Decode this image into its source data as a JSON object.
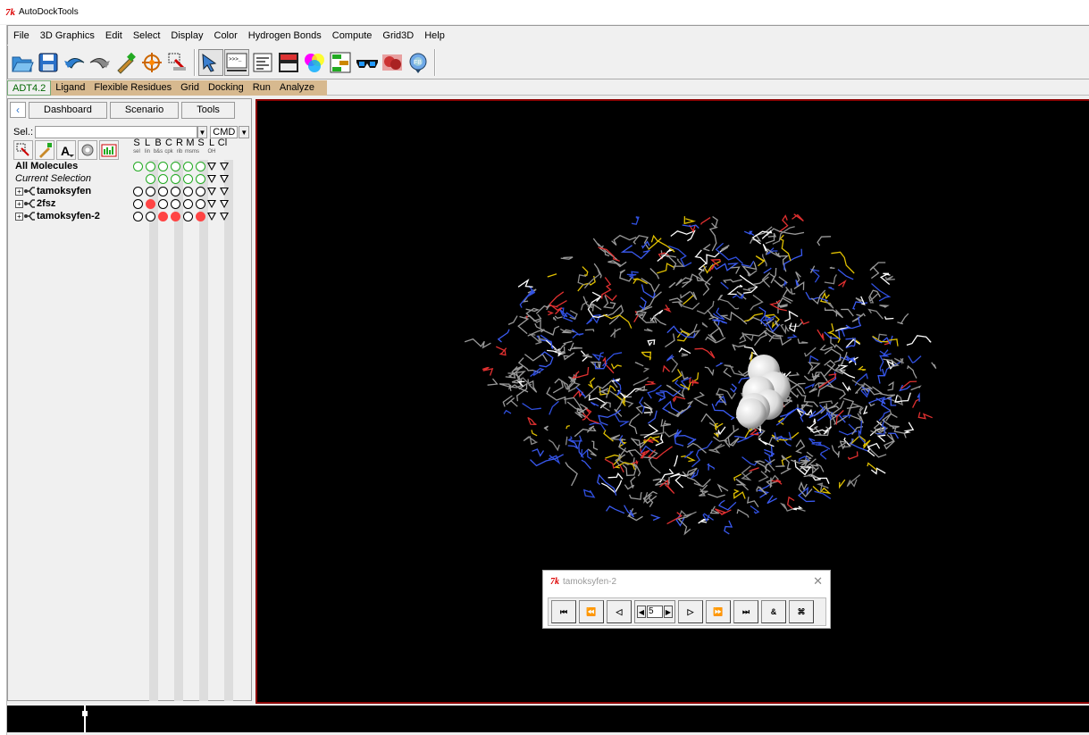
{
  "window": {
    "title": "AutoDockTools",
    "logo": "7k"
  },
  "menubar": [
    "File",
    "3D Graphics",
    "Edit",
    "Select",
    "Display",
    "Color",
    "Hydrogen Bonds",
    "Compute",
    "Grid3D",
    "Help"
  ],
  "toolbar": {
    "icons": [
      "open-folder-icon",
      "save-icon",
      "undo-icon",
      "redo-icon",
      "pick-icon",
      "center-icon",
      "clear-selection-icon",
      "pointer-icon",
      "python-shell-icon",
      "label-icon",
      "display-icon",
      "color-icon",
      "hierarchy-icon",
      "stereo-glasses-icon",
      "surface-icon",
      "fog-icon"
    ]
  },
  "modules": {
    "active": "ADT4.2",
    "items": [
      "Ligand",
      "Flexible Residues",
      "Grid",
      "Docking",
      "Run",
      "Analyze"
    ]
  },
  "dashboard": {
    "tabs": [
      "Dashboard",
      "Scenario",
      "Tools"
    ],
    "sel_label": "Sel.:",
    "sel_value": "",
    "cmd_label": "CMD",
    "columns": [
      {
        "letter": "S",
        "sub": "sel"
      },
      {
        "letter": "L",
        "sub": "lin"
      },
      {
        "letter": "B",
        "sub": "b&s"
      },
      {
        "letter": "C",
        "sub": "cpk"
      },
      {
        "letter": "R",
        "sub": "rib"
      },
      {
        "letter": "M",
        "sub": "msms"
      },
      {
        "letter": "S",
        "sub": ""
      },
      {
        "letter": "L",
        "sub": "OH"
      },
      {
        "letter": "Cl",
        "sub": ""
      }
    ],
    "rows": [
      {
        "label": "All Molecules",
        "style": "bold",
        "expandable": false,
        "states": [
          "g",
          "g",
          "g",
          "g",
          "g",
          "g",
          "t",
          "t"
        ]
      },
      {
        "label": "Current Selection",
        "style": "italic",
        "expandable": false,
        "states": [
          "",
          "g",
          "g",
          "g",
          "g",
          "g",
          "t",
          "t"
        ]
      },
      {
        "label": "tamoksyfen",
        "style": "mol",
        "expandable": true,
        "states": [
          "o",
          "o",
          "o",
          "o",
          "o",
          "o",
          "t",
          "t"
        ]
      },
      {
        "label": "2fsz",
        "style": "mol",
        "expandable": true,
        "states": [
          "o",
          "r",
          "o",
          "o",
          "o",
          "o",
          "t",
          "t"
        ]
      },
      {
        "label": "tamoksyfen-2",
        "style": "mol",
        "expandable": true,
        "states": [
          "o",
          "o",
          "r",
          "r",
          "o",
          "r",
          "t",
          "t"
        ]
      }
    ]
  },
  "player": {
    "title": "tamoksyfen-2",
    "frame": "5",
    "buttons": [
      "first-frame-icon",
      "rewind-icon",
      "play-reverse-icon",
      "play-icon",
      "fast-forward-icon",
      "last-frame-icon",
      "record-icon",
      "settings-icon"
    ]
  },
  "colors": {
    "viewer_bg": "#000000",
    "viewer_border": "#8b0000",
    "module_bar": "#d7b98f"
  }
}
